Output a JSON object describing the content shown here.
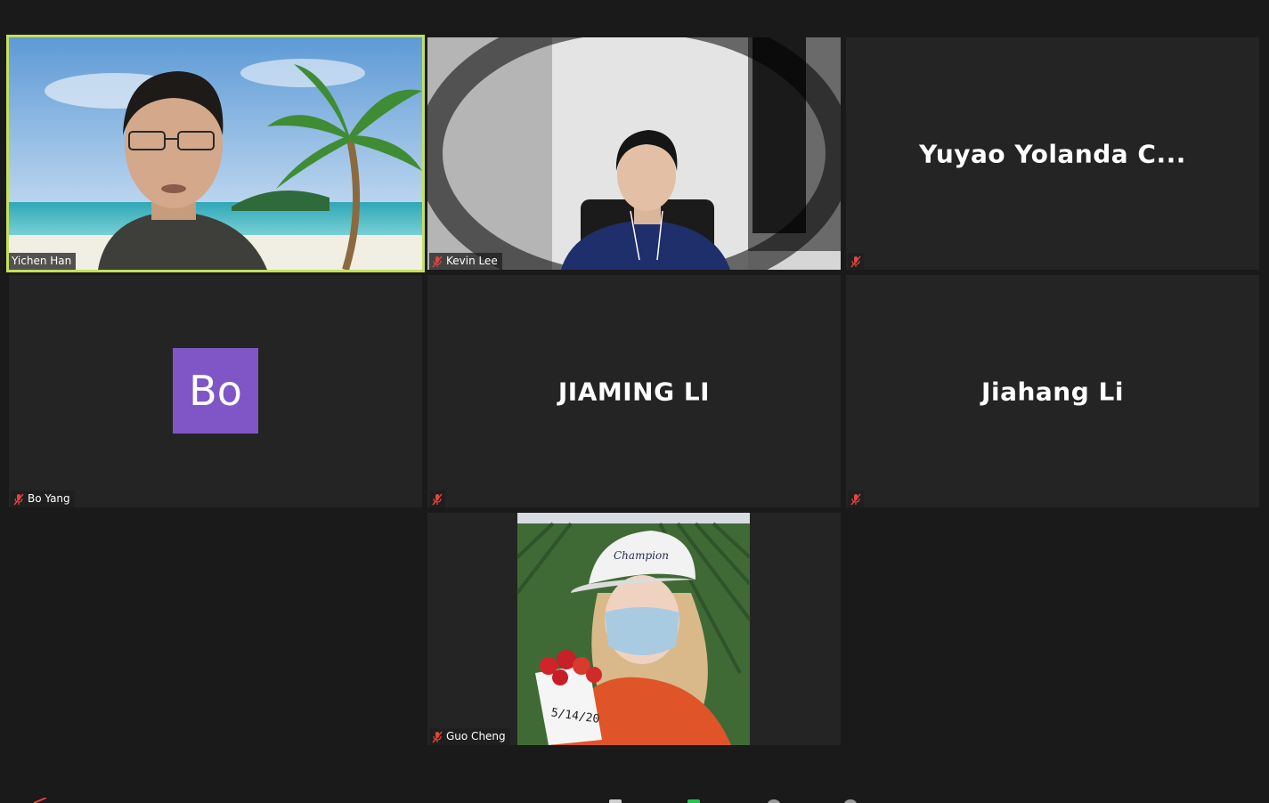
{
  "participants": [
    {
      "name": "Yichen Han",
      "muted": false,
      "active_speaker": true,
      "video": "beach"
    },
    {
      "name": "Kevin Lee",
      "muted": true,
      "video": "room"
    },
    {
      "name": "Yuyao Yolanda C...",
      "muted": true,
      "video": "off"
    },
    {
      "name": "Bo Yang",
      "muted": true,
      "video": "off",
      "avatar_text": "Bo",
      "avatar_color": "#8056c6"
    },
    {
      "name": "JIAMING LI",
      "muted": true,
      "video": "off"
    },
    {
      "name": "Jiahang Li",
      "muted": true,
      "video": "off"
    },
    {
      "name": "Guo Cheng",
      "muted": true,
      "video": "strawberry-field"
    }
  ],
  "colors": {
    "active_border": "#c3e05b",
    "mic_off": "#e0443e",
    "tile_bg": "#242424",
    "app_bg": "#1a1a1a"
  }
}
